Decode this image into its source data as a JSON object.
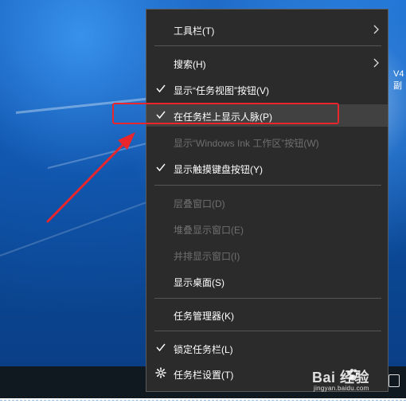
{
  "menu": {
    "items": [
      {
        "label": "工具栏(T)",
        "checked": false,
        "disabled": false,
        "submenu": true
      },
      {
        "label": "搜索(H)",
        "checked": false,
        "disabled": false,
        "submenu": true
      },
      {
        "label": "显示“任务视图”按钮(V)",
        "checked": true,
        "disabled": false,
        "submenu": false
      },
      {
        "label": "在任务栏上显示人脉(P)",
        "checked": true,
        "disabled": false,
        "submenu": false,
        "hover": true
      },
      {
        "label": "显示“Windows Ink 工作区”按钮(W)",
        "checked": false,
        "disabled": true,
        "submenu": false
      },
      {
        "label": "显示触摸键盘按钮(Y)",
        "checked": true,
        "disabled": false,
        "submenu": false
      },
      {
        "label": "层叠窗口(D)",
        "checked": false,
        "disabled": true,
        "submenu": false
      },
      {
        "label": "堆叠显示窗口(E)",
        "checked": false,
        "disabled": true,
        "submenu": false
      },
      {
        "label": "并排显示窗口(I)",
        "checked": false,
        "disabled": true,
        "submenu": false
      },
      {
        "label": "显示桌面(S)",
        "checked": false,
        "disabled": false,
        "submenu": false
      },
      {
        "label": "任务管理器(K)",
        "checked": false,
        "disabled": false,
        "submenu": false
      },
      {
        "label": "锁定任务栏(L)",
        "checked": true,
        "disabled": false,
        "submenu": false
      },
      {
        "label": "任务栏设置(T)",
        "checked": false,
        "disabled": false,
        "submenu": false,
        "icon": "gear-icon"
      }
    ]
  },
  "desktop": {
    "side_text_1": "V4",
    "side_text_2": "副"
  },
  "watermark": {
    "brand": "Bai  经验",
    "url": "jingyan.baidu.com"
  },
  "colors": {
    "menu_bg": "#2b2b2b",
    "menu_hover": "#414141",
    "disabled_text": "#6f6f6f",
    "annotation_red": "#e8262b"
  }
}
